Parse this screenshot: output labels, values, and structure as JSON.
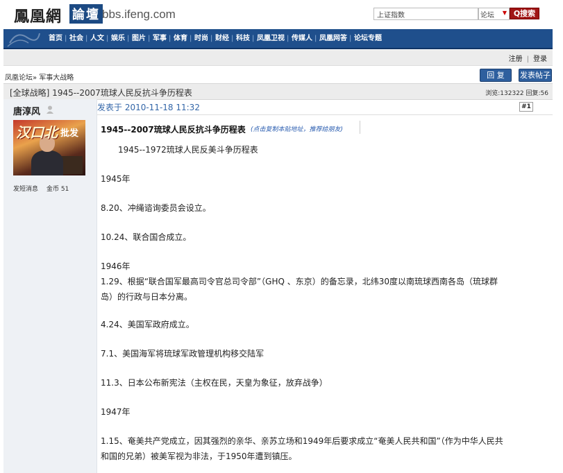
{
  "header": {
    "logo_text": "鳳凰網",
    "logo_box_text": "論壇",
    "domain": "bbs.ifeng.com",
    "search_value": "上证指数",
    "scope_value": "论坛",
    "search_button": "Q搜索"
  },
  "nav": {
    "items": [
      "首页",
      "社会",
      "人文",
      "娱乐",
      "图片",
      "军事",
      "体育",
      "时尚",
      "财经",
      "科技",
      "凤凰卫视",
      "传媒人",
      "凤凰网答",
      "论坛专题"
    ]
  },
  "userbar": {
    "register": "注册",
    "login": "登录"
  },
  "breadcrumb": "凤凰论坛» 军事大战略",
  "actions": {
    "reply": "回 复",
    "new_post": "发表帖子"
  },
  "thread": {
    "title": "[全球战略] 1945--2007琉球人民反抗斗争历程表",
    "stats": "浏览:132322 回复:56"
  },
  "author": {
    "name": "唐淳风",
    "avatar_banner": "汉口北",
    "avatar_banner2": "批发",
    "send_message": "发短消息",
    "coins": "金币 51"
  },
  "post": {
    "posted": "发表于 2010-11-18 11:32",
    "floor": "#1",
    "title": "1945--2007琉球人民反抗斗争历程表",
    "copy_hint": "(点击复制本贴地址，推荐给朋友)",
    "lines": [
      "  1945--1972琉球人民反美斗争历程表",
      "1945年",
      "8.20、冲绳谘询委员会设立。",
      "10.24、联合国合成立。",
      "1946年",
      "1.29、根据“联合国军最高司令官总司令部”（GHQ 、东京）的备忘录，北纬30度以南琉球西南各岛（琉球群",
      "岛）的行政与日本分离。",
      "4.24、美国军政府成立。",
      "7.1、美国海军将琉球军政管理机构移交陆军",
      "11.3、日本公布新宪法（主权在民，天皇为象征，放弃战争）",
      "1947年",
      "1.15、奄美共产党成立，因其强烈的亲华、亲苏立场和1949年后要求成立“奄美人民共和国”（作为中华人民共",
      "和国的兄弟）被美军视为非法，于1950年遭到镇压。"
    ]
  }
}
